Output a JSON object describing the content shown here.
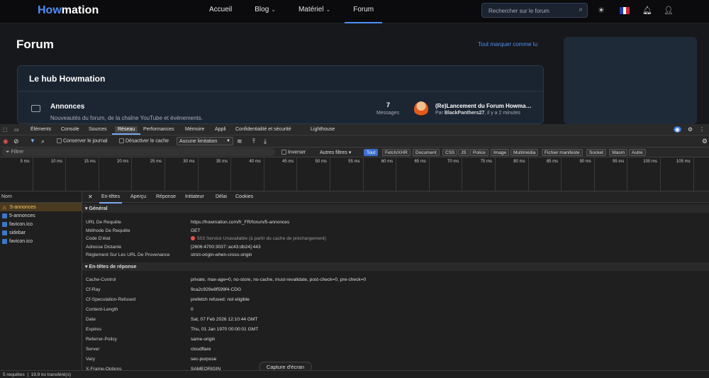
{
  "site": {
    "logo": {
      "part1": "How",
      "part2": "mation"
    },
    "nav": [
      {
        "label": "Accueil",
        "chev": ""
      },
      {
        "label": "Blog",
        "chev": "⌄"
      },
      {
        "label": "Matériel",
        "chev": "⌄"
      },
      {
        "label": "Forum",
        "chev": ""
      }
    ],
    "search_placeholder": "Rechercher sur le forum",
    "page_title": "Forum",
    "mark_read": "Tout marquer comme lu",
    "hub": {
      "title": "Le hub Howmation",
      "category": "Annonces",
      "description": "Nouveautés du forum, de la chaîne YouTube et événements.",
      "messages_count": "7",
      "messages_label": "Messages",
      "last_post_title": "(Re)Lancement du Forum Howma…",
      "last_post_by_prefix": "Par",
      "last_post_author": "BlackPanthers27",
      "last_post_time": ", il y a 2 minutes"
    },
    "flag_colors": [
      "#1f3fa8",
      "#ffffff",
      "#d1283a"
    ]
  },
  "devtools": {
    "tabs": [
      "Éléments",
      "Console",
      "Sources",
      "Réseau",
      "Performances",
      "Mémoire",
      "Appli",
      "Confidentialité et sécurité",
      "Lighthouse"
    ],
    "toolbar": {
      "preserve_log": "Conserver le journal",
      "disable_cache": "Désactiver le cache",
      "throttle": "Aucune limitation"
    },
    "filter": {
      "placeholder": "Filtrer",
      "invert": "Inverser",
      "more_filters": "Autres filtres"
    },
    "type_filters": [
      "Tout",
      "Fetch/XHR",
      "Document",
      "CSS",
      "JS",
      "Police",
      "Image",
      "Multimédia",
      "Fichier manifeste",
      "Socket",
      "Wasm",
      "Autre"
    ],
    "timeline_ticks": [
      "5 ms",
      "10 ms",
      "15 ms",
      "20 ms",
      "25 ms",
      "30 ms",
      "35 ms",
      "40 ms",
      "45 ms",
      "50 ms",
      "55 ms",
      "60 ms",
      "65 ms",
      "70 ms",
      "75 ms",
      "80 ms",
      "85 ms",
      "90 ms",
      "95 ms",
      "100 ms",
      "105 ms"
    ],
    "requests_header": "Nom",
    "requests": [
      {
        "name": "5-annonces",
        "status": "error"
      },
      {
        "name": "5-annonces",
        "status": "ok"
      },
      {
        "name": "favicon.ico",
        "status": "ok"
      },
      {
        "name": "sidebar",
        "status": "ok"
      },
      {
        "name": "favicon.ico",
        "status": "ok"
      }
    ],
    "summary": {
      "requests": "5 requêtes",
      "transferred": "19,9 ko transféré(s)"
    },
    "detail_tabs": [
      "En-têtes",
      "Aperçu",
      "Réponse",
      "Initiateur",
      "Délai",
      "Cookies"
    ],
    "general_title": "Général",
    "general": [
      {
        "k": "URL De Requête",
        "v": "https://howmation.com/fr_FR/forum/5-annonces"
      },
      {
        "k": "Méthode De Requête",
        "v": "GET"
      },
      {
        "k": "Code D'état",
        "v": "503 Service Unavailable (à partir du cache de préchargement)"
      },
      {
        "k": "Adresse Distante",
        "v": "[2606:4700:3037::ac43:db24]:443"
      },
      {
        "k": "Règlement Sur Les URL De Provenance",
        "v": "strict-origin-when-cross-origin"
      }
    ],
    "response_title": "En-têtes de réponse",
    "response_headers": [
      {
        "k": "Cache-Control",
        "v": "private, max-age=0, no-store, no-cache, must-revalidate, post-check=0, pre-check=0"
      },
      {
        "k": "Cf-Ray",
        "v": "9ca2c929e8f599f4-CDG"
      },
      {
        "k": "Cf-Speculation-Refused",
        "v": "prefetch refused: not eligible"
      },
      {
        "k": "Content-Length",
        "v": "0"
      },
      {
        "k": "Date",
        "v": "Sat, 07 Feb 2026 12:10:44 GMT"
      },
      {
        "k": "Expires",
        "v": "Thu, 01 Jan 1970 00:00:01 GMT"
      },
      {
        "k": "Referrer-Policy",
        "v": "same-origin"
      },
      {
        "k": "Server",
        "v": "cloudflare"
      },
      {
        "k": "Vary",
        "v": "sec-purpose"
      },
      {
        "k": "X-Frame-Options",
        "v": "SAMEORIGIN"
      }
    ],
    "screenshot_button": "Capture d'écran",
    "accent": "#7cacf8",
    "error_color": "#e2574c"
  }
}
